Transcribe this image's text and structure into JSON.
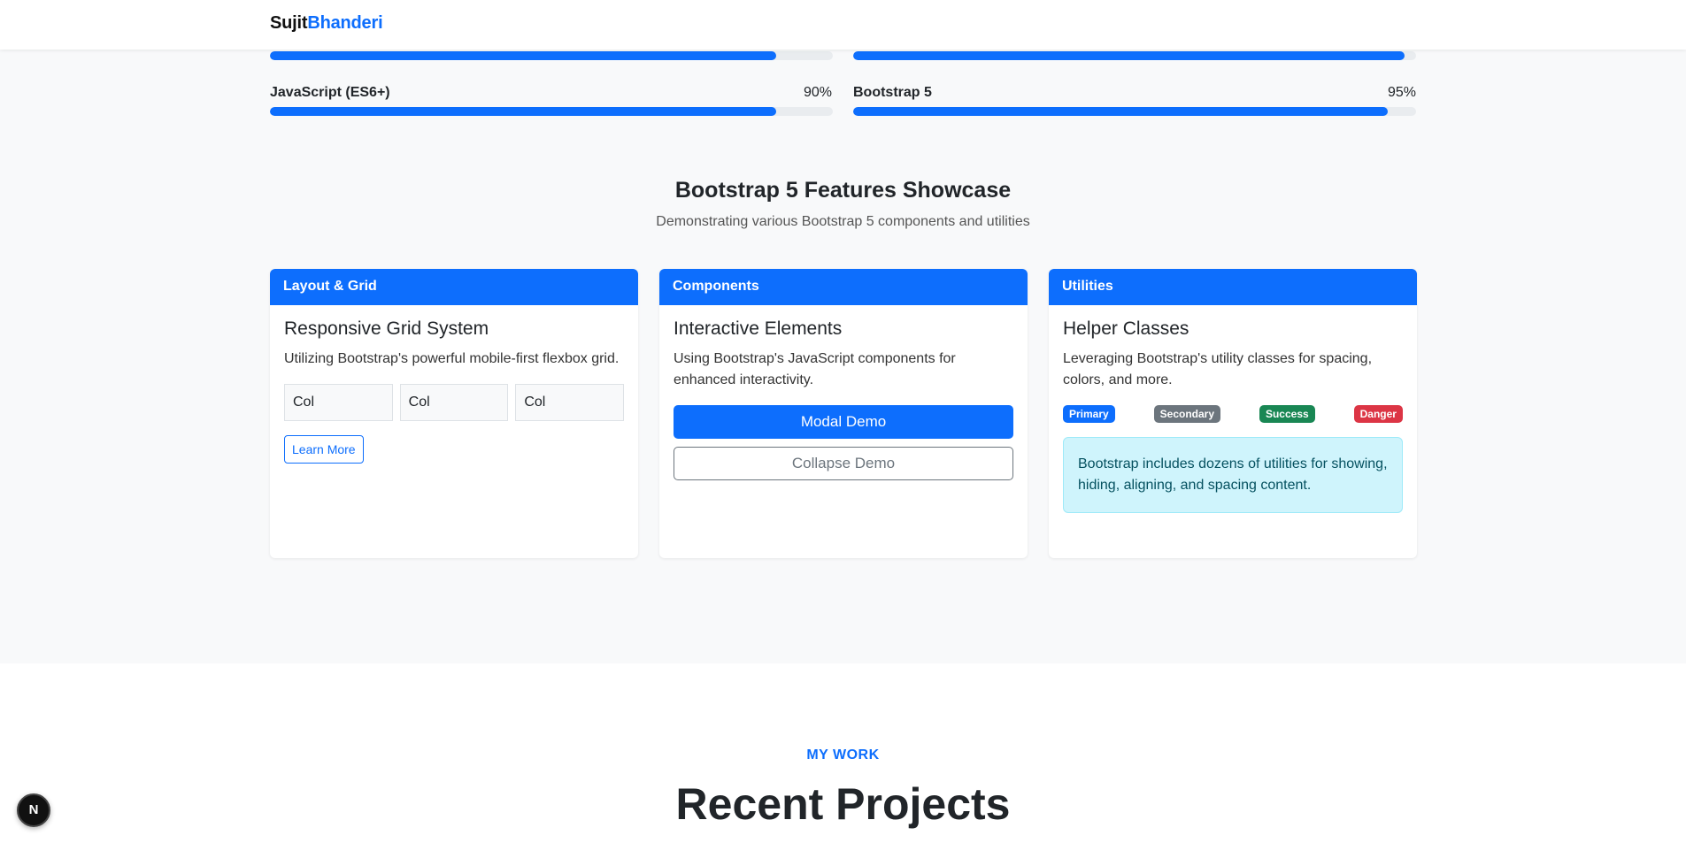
{
  "navbar": {
    "brand_first": "Sujit",
    "brand_last": "Bhanderi"
  },
  "skills": {
    "left": [
      {
        "name": "",
        "percent_text": "",
        "fill": 0.9
      },
      {
        "name": "JavaScript (ES6+)",
        "percent_text": "90%",
        "fill": 0.9
      }
    ],
    "right": [
      {
        "name": "",
        "percent_text": "",
        "fill": 0.98
      },
      {
        "name": "Bootstrap 5",
        "percent_text": "95%",
        "fill": 0.95
      }
    ]
  },
  "showcase": {
    "title": "Bootstrap 5 Features Showcase",
    "subtitle": "Demonstrating various Bootstrap 5 components and utilities",
    "cards": [
      {
        "header": "Layout & Grid",
        "title": "Responsive Grid System",
        "text": "Utilizing Bootstrap's powerful mobile-first flexbox grid.",
        "cols": [
          "Col",
          "Col",
          "Col"
        ],
        "button": "Learn More"
      },
      {
        "header": "Components",
        "title": "Interactive Elements",
        "text": "Using Bootstrap's JavaScript components for enhanced interactivity.",
        "primary_button": "Modal Demo",
        "outline_button": "Collapse Demo"
      },
      {
        "header": "Utilities",
        "title": "Helper Classes",
        "text": "Leveraging Bootstrap's utility classes for spacing, colors, and more.",
        "badges": [
          {
            "label": "Primary",
            "color": "#0d6efd"
          },
          {
            "label": "Secondary",
            "color": "#6c757d"
          },
          {
            "label": "Success",
            "color": "#198754"
          },
          {
            "label": "Danger",
            "color": "#dc3545"
          }
        ],
        "alert": "Bootstrap includes dozens of utilities for showing, hiding, aligning, and spacing content."
      }
    ]
  },
  "work": {
    "eyebrow": "MY WORK",
    "title": "Recent Projects"
  },
  "dev_badge": {
    "letter": "N"
  },
  "colors": {
    "accent": "#0d6efd",
    "page_bg": "#f8f9fa"
  }
}
